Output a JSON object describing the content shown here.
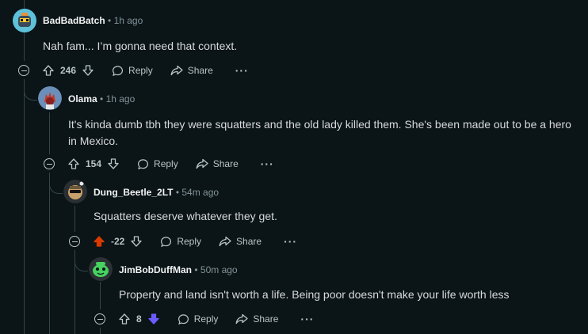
{
  "comments": [
    {
      "author": "BadBadBatch",
      "time": "1h ago",
      "body": "Nah fam... I’m gonna need that context.",
      "score": "246",
      "reply_label": "Reply",
      "share_label": "Share"
    },
    {
      "author": "Olama",
      "time": "1h ago",
      "body": "It's kinda dumb tbh they were squatters and the old lady killed them. She's been made out to be a hero in Mexico.",
      "score": "154",
      "reply_label": "Reply",
      "share_label": "Share"
    },
    {
      "author": "Dung_Beetle_2LT",
      "time": "54m ago",
      "body": "Squatters deserve whatever they get.",
      "score": "-22",
      "reply_label": "Reply",
      "share_label": "Share",
      "vote": "up"
    },
    {
      "author": "JimBobDuffMan",
      "time": "50m ago",
      "body": "Property and land isn't worth a life. Being poor doesn't make your life worth less",
      "score": "8",
      "reply_label": "Reply",
      "share_label": "Share",
      "vote": "down"
    }
  ],
  "separator": "•",
  "more_label": "···",
  "colors": {
    "background": "#0b1416",
    "upvote_active": "#d93a00",
    "downvote_active": "#6a5cff"
  }
}
